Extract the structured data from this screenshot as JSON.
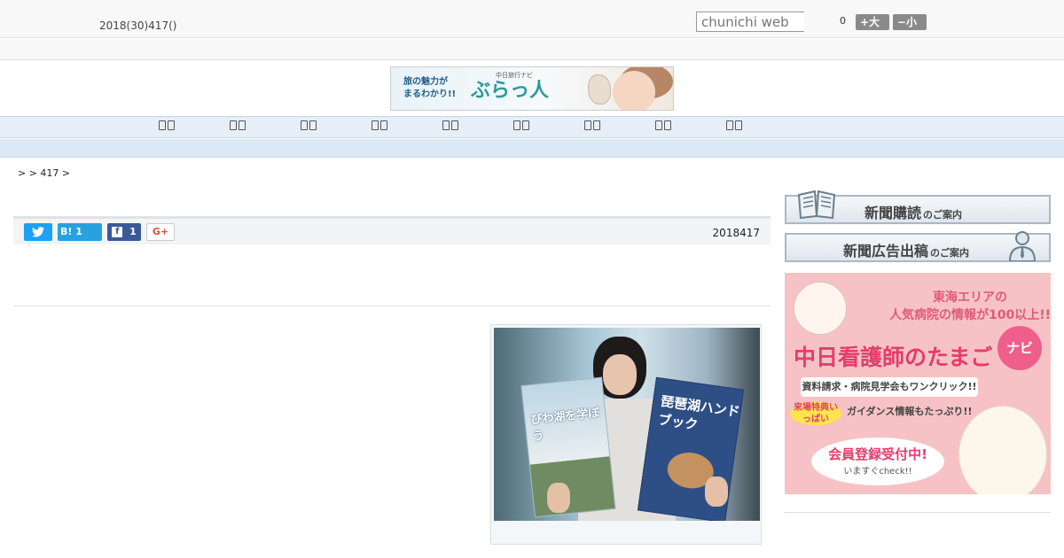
{
  "header": {
    "date": "2018(30)417()",
    "search_placeholder": "chunichi web",
    "count": "0",
    "font_bigger_label": "+大",
    "font_smaller_label": "−小"
  },
  "banner": {
    "line1": "旅の魅力が",
    "line2": "まるわかり!!",
    "brand": "ぶらっ人",
    "small": "中日旅行ナビ"
  },
  "nav": {
    "items": [
      "",
      "",
      "",
      "",
      "",
      "",
      "",
      "",
      ""
    ]
  },
  "breadcrumb": ">  > 417 >",
  "share": {
    "hatena_label": "B! 1",
    "facebook_count": "1",
    "gplus_label": "G+",
    "date": "2018417"
  },
  "photo": {
    "book1_title": "びわ湖を学ぼう",
    "book2_title": "琵琶湖ハンドブック"
  },
  "sidebar": {
    "subscribe_label": "新聞購読",
    "subscribe_suffix": "のご案内",
    "ad_label": "新聞広告出稿",
    "ad_suffix": "のご案内"
  },
  "promo": {
    "line1": "東海エリアの",
    "line2": "人気病院の情報が100以上!!",
    "title": "中日看護師のたまご",
    "badge": "ナビ",
    "sub1": "資料請求・病院見学会もワンクリック!!",
    "special": "来場特典いっぱい",
    "sub2": "ガイダンス情報もたっぷり!!",
    "cta": "会員登録受付中!",
    "cta_sub": "いますぐcheck!!"
  },
  "colors": {
    "twitter": "#1da1f2",
    "hatena": "#29a0e0",
    "facebook": "#3b5998",
    "promo_pink": "#e43d6b"
  }
}
